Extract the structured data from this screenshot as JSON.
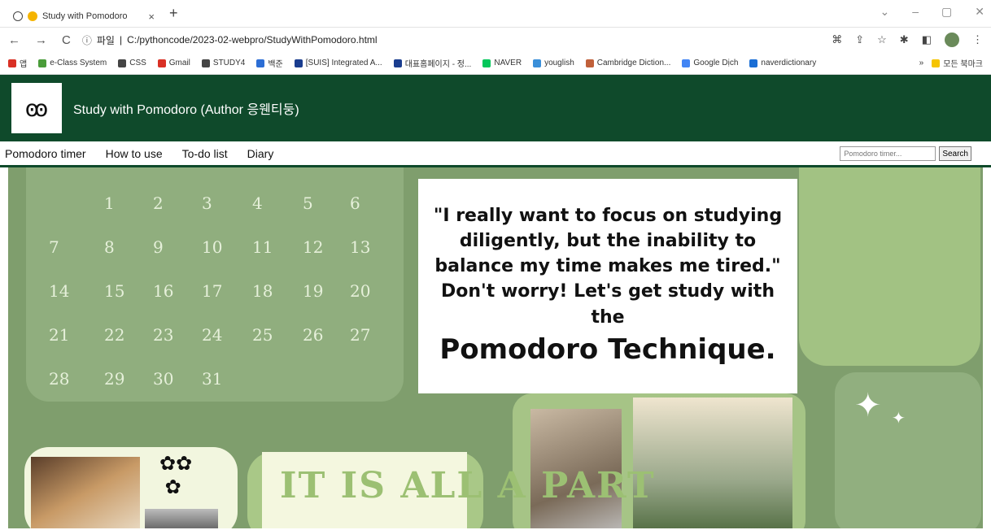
{
  "browser": {
    "tab_title": "Study with Pomodoro",
    "tab_close": "×",
    "new_tab": "+",
    "url_prefix": "파일",
    "url": "C:/pythoncode/2023-02-webpro/StudyWithPomodoro.html",
    "back": "←",
    "forward": "→",
    "reload": "C",
    "info_icon": "ⓘ",
    "bookmarks": [
      {
        "label": "앱",
        "color": "#d93025"
      },
      {
        "label": "e-Class System",
        "color": "#4a9c3a"
      },
      {
        "label": "CSS",
        "color": "#444444"
      },
      {
        "label": "Gmail",
        "color": "#d93025"
      },
      {
        "label": "STUDY4",
        "color": "#444444"
      },
      {
        "label": "백준",
        "color": "#2c6ed5"
      },
      {
        "label": "[SUIS] Integrated A...",
        "color": "#1a3d8f"
      },
      {
        "label": "대표홈페이지 - 정...",
        "color": "#1a3d8f"
      },
      {
        "label": "NAVER",
        "color": "#03c75a"
      },
      {
        "label": "youglish",
        "color": "#3a8fd9"
      },
      {
        "label": "Cambridge Diction...",
        "color": "#c0603a"
      },
      {
        "label": "Google Dịch",
        "color": "#4285f4"
      },
      {
        "label": "naverdictionary",
        "color": "#1a6ed5"
      }
    ],
    "bookmarks_more": "»",
    "all_bookmarks": "모든 북마크"
  },
  "site": {
    "title": "Study with Pomodoro (Author 응웬티둥)",
    "nav": [
      "Pomodoro timer",
      "How to use",
      "To-do list",
      "Diary"
    ],
    "search_placeholder": "Pomodoro timer...",
    "search_button": "Search"
  },
  "calendar": {
    "days": [
      "1",
      "2",
      "3",
      "4",
      "5",
      "6",
      "7",
      "8",
      "9",
      "10",
      "11",
      "12",
      "13",
      "14",
      "15",
      "16",
      "17",
      "18",
      "19",
      "20",
      "21",
      "22",
      "23",
      "24",
      "25",
      "26",
      "27",
      "28",
      "29",
      "30",
      "31"
    ],
    "first_weekday": 1
  },
  "quote": {
    "text": "\"I really want to focus on studying diligently, but the inability to balance my time makes me tired.\" Don't worry! Let's get study with the",
    "emphasis": "Pomodoro Technique."
  },
  "sticker": {
    "text": "IT IS ALL A PART"
  },
  "colors": {
    "header_bg": "#0f4a2b",
    "content_bg": "#7f9e6d"
  }
}
